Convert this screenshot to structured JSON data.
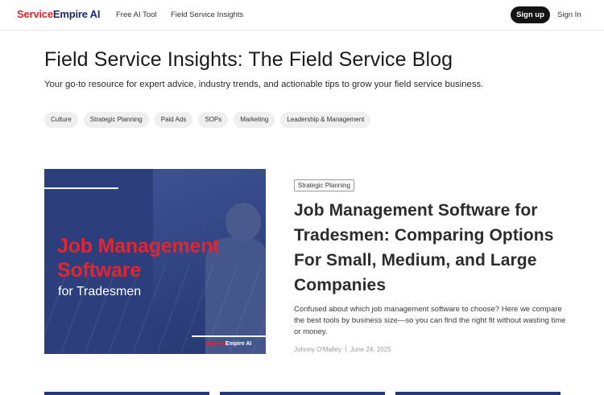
{
  "header": {
    "logo_part1": "Service",
    "logo_part2": "Empire AI",
    "nav": [
      "Free AI Tool",
      "Field Service Insights"
    ],
    "signup_label": "Sign up",
    "signin_label": "Sign In"
  },
  "hero": {
    "title": "Field Service Insights: The Field Service Blog",
    "subtitle": "Your go-to resource for expert advice, industry trends, and actionable tips to grow your field service business."
  },
  "tags": [
    "Culture",
    "Strategic Planning",
    "Paid Ads",
    "SOPs",
    "Marketing",
    "Leadership & Management"
  ],
  "featured": {
    "image_title_line1": "Job Management",
    "image_title_line2": "Software",
    "image_subtitle": "for Tradesmen",
    "image_logo_part1": "Service",
    "image_logo_part2": "Empire AI",
    "category": "Strategic Planning",
    "title": "Job Management Software for Tradesmen: Comparing Options For Small, Medium, and Large Companies",
    "excerpt": "Confused about which job management software to choose? Here we compare the best tools by business size—so you can find the right fit without wasting time or money.",
    "author": "Johnny O'Malley",
    "date": "June 24, 2025"
  },
  "colors": {
    "brand_red": "#d8262b",
    "brand_navy": "#1b2a6b",
    "image_bg": "#2c3f7c"
  }
}
